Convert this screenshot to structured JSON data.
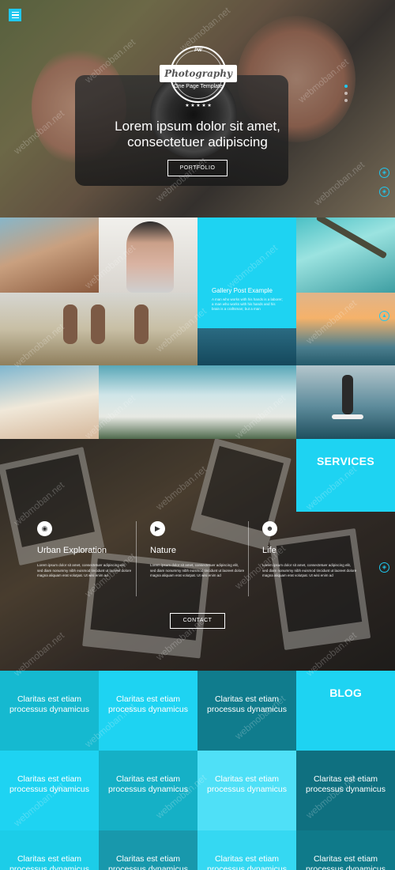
{
  "hero": {
    "logo_top": "PW",
    "logo_title": "Photography",
    "logo_sub": "One Page Template",
    "logo_stars": "★ ★ ★ ★ ★",
    "headline_line1": "Lorem ipsum dolor sit amet,",
    "headline_line2": "consectetuer adipiscing",
    "button": "PORTFOLIO"
  },
  "gallery": {
    "post_title": "Gallery Post Example",
    "post_text": "A man who works with his hands is a laborer; a man who works with his hands and his brain is a craftsman; but a man"
  },
  "services": {
    "title": "SERVICES",
    "items": [
      {
        "icon": "camera-icon",
        "title": "Urban Exploration",
        "text": "Lorem ipsum dolor sit amet, consectetuer adipiscing elit, sed diam nonummy nibh euismod tincidunt ut laoreet dolore magna aliquam erat volutpat. Ut wisi enim ad"
      },
      {
        "icon": "video-icon",
        "title": "Nature",
        "text": "Lorem ipsum dolor sit amet, consectetuer adipiscing elit, sed diam nonummy nibh euismod tincidunt ut laoreet dolore magna aliquam erat volutpat. Ut wisi enim ad"
      },
      {
        "icon": "user-icon",
        "title": "Life",
        "text": "Lorem ipsum dolor sit amet, consectetuer adipiscing elit, sed diam nonummy nibh euismod tincidunt ut laoreet dolore magna aliquam erat volutpat. Ut wisi enim ad"
      }
    ],
    "button": "CONTACT"
  },
  "blog": {
    "title": "BLOG",
    "cells": [
      {
        "text": "Claritas est etiam processus dynamicus",
        "color": "#15b9d0"
      },
      {
        "text": "Claritas est etiam processus dynamicus",
        "color": "#1ed3f2"
      },
      {
        "text": "Claritas est etiam processus dynamicus",
        "color": "#107c8d"
      },
      {
        "text": "Claritas est etiam processus dynamicus",
        "color": "#1ed3f2"
      },
      {
        "text": "Claritas est etiam processus dynamicus",
        "color": "#15b0c6"
      },
      {
        "text": "Claritas est etiam processus dynamicus",
        "color": "#4fe0f7"
      },
      {
        "text": "Claritas est etiam processus dynamicus",
        "color": "#0f7080"
      },
      {
        "text": "Claritas est etiam processus dynamicus",
        "color": "#1ccde8"
      },
      {
        "text": "Claritas est etiam processus dynamicus",
        "color": "#1898ac"
      },
      {
        "text": "Claritas est etiam processus dynamicus",
        "color": "#35d8f2"
      },
      {
        "text": "Claritas est etiam processus dynamicus",
        "color": "#0f7a8a"
      }
    ]
  },
  "watermark": "webmoban.net",
  "colors": {
    "accent": "#1ed3f2"
  }
}
